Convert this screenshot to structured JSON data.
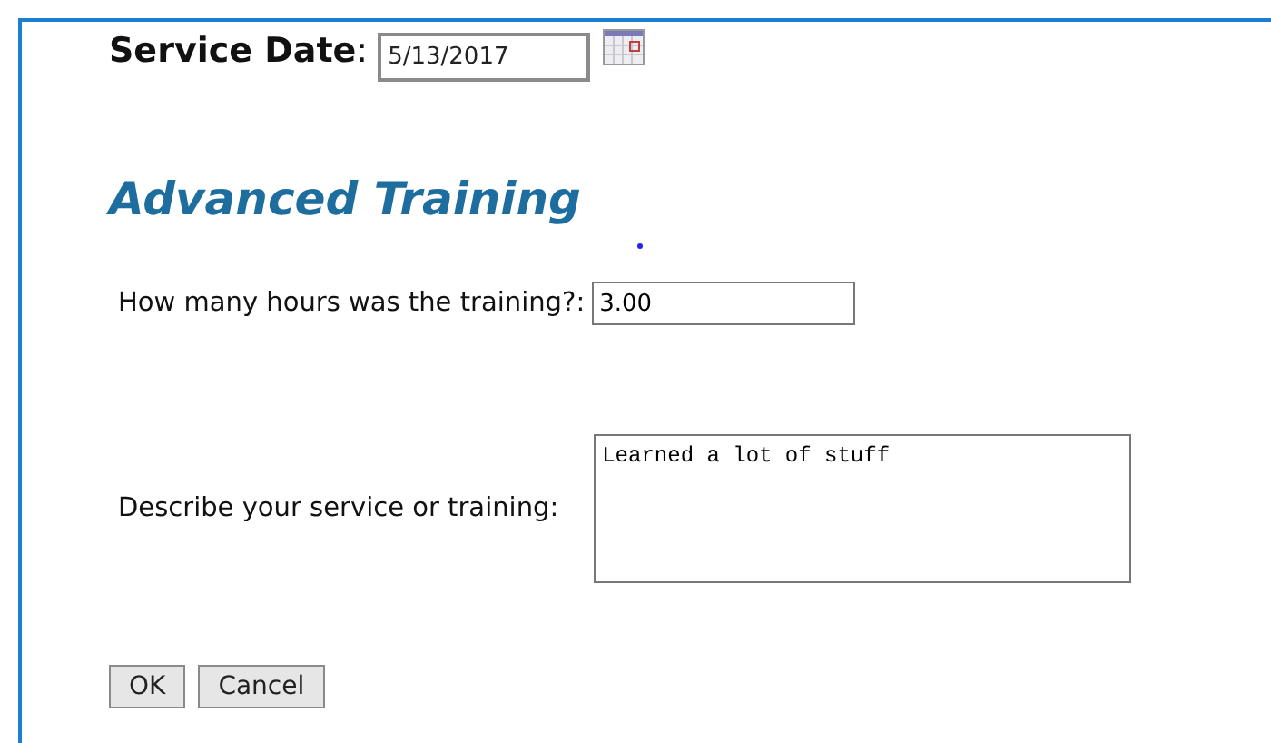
{
  "service_date": {
    "label": "Service Date",
    "colon": ":",
    "value": "5/13/2017"
  },
  "heading": "Advanced Training",
  "hours": {
    "label": "How many hours was the training?:",
    "value": "3.00"
  },
  "description": {
    "label": "Describe your service or training:",
    "value": "Learned a lot of stuff"
  },
  "buttons": [
    "OK",
    "Cancel"
  ]
}
